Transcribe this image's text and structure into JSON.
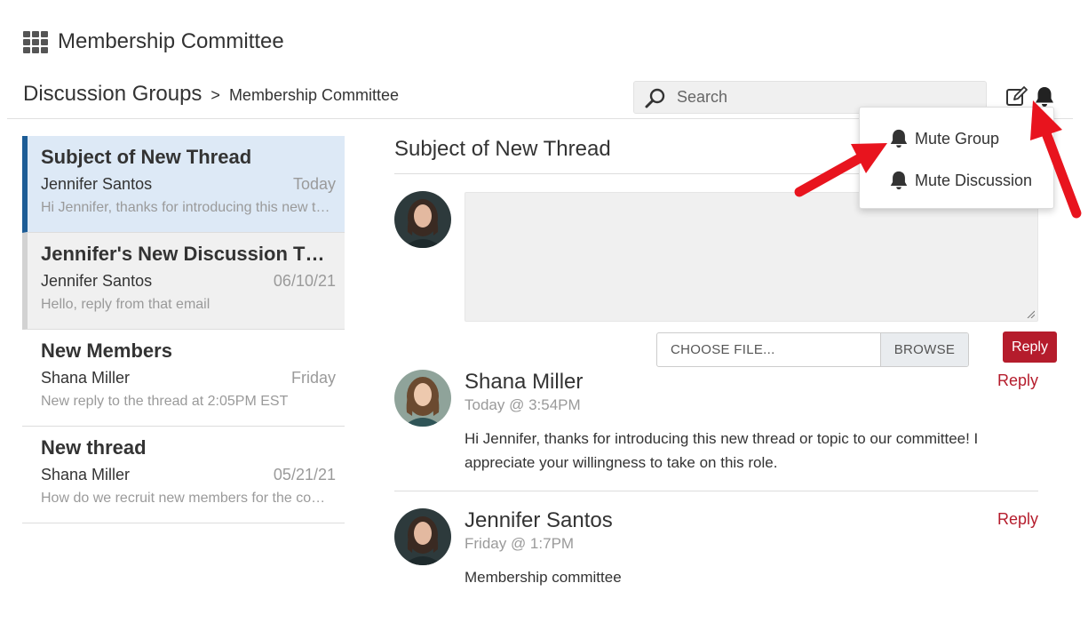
{
  "app": {
    "title": "Membership Committee"
  },
  "breadcrumb": {
    "root": "Discussion Groups",
    "separator": ">",
    "current": "Membership Committee"
  },
  "search": {
    "placeholder": "Search",
    "value": ""
  },
  "threads": [
    {
      "subject": "Subject of New Thread",
      "author": "Jennifer Santos",
      "date": "Today",
      "preview": "Hi Jennifer, thanks for introducing this new thread or topic to our committee!",
      "state": "active"
    },
    {
      "subject": "Jennifer's New Discussion Thread",
      "author": "Jennifer Santos",
      "date": "06/10/21",
      "preview": "Hello, reply from that email",
      "state": "unread"
    },
    {
      "subject": "New Members",
      "author": "Shana Miller",
      "date": "Friday",
      "preview": "New reply to the thread at 2:05PM EST",
      "state": "read"
    },
    {
      "subject": "New thread",
      "author": "Shana Miller",
      "date": "05/21/21",
      "preview": "How do we recruit new members for the committee?",
      "state": "read"
    }
  ],
  "main": {
    "thread_title": "Subject of New Thread",
    "reply_box": {
      "value": ""
    },
    "file": {
      "choose_label": "CHOOSE FILE...",
      "browse_label": "BROWSE"
    },
    "reply_button_label": "Reply",
    "posts": [
      {
        "author": "Shana Miller",
        "time": "Today @ 3:54PM",
        "reply_label": "Reply",
        "body": "Hi Jennifer, thanks for introducing this new thread or topic to our committee! I appreciate your willingness to take on this role."
      },
      {
        "author": "Jennifer Santos",
        "time": "Friday @ 1:7PM",
        "reply_label": "Reply",
        "body": "Membership committee"
      }
    ]
  },
  "mute_menu": {
    "items": [
      "Mute Group",
      "Mute Discussion"
    ]
  },
  "colors": {
    "accent": "#1c5c96",
    "reply": "#b51c2c",
    "annotation": "#e8141e",
    "active_bg": "#dde9f6"
  },
  "icons": [
    "grid-icon",
    "search-icon",
    "compose-icon",
    "bell-icon"
  ]
}
